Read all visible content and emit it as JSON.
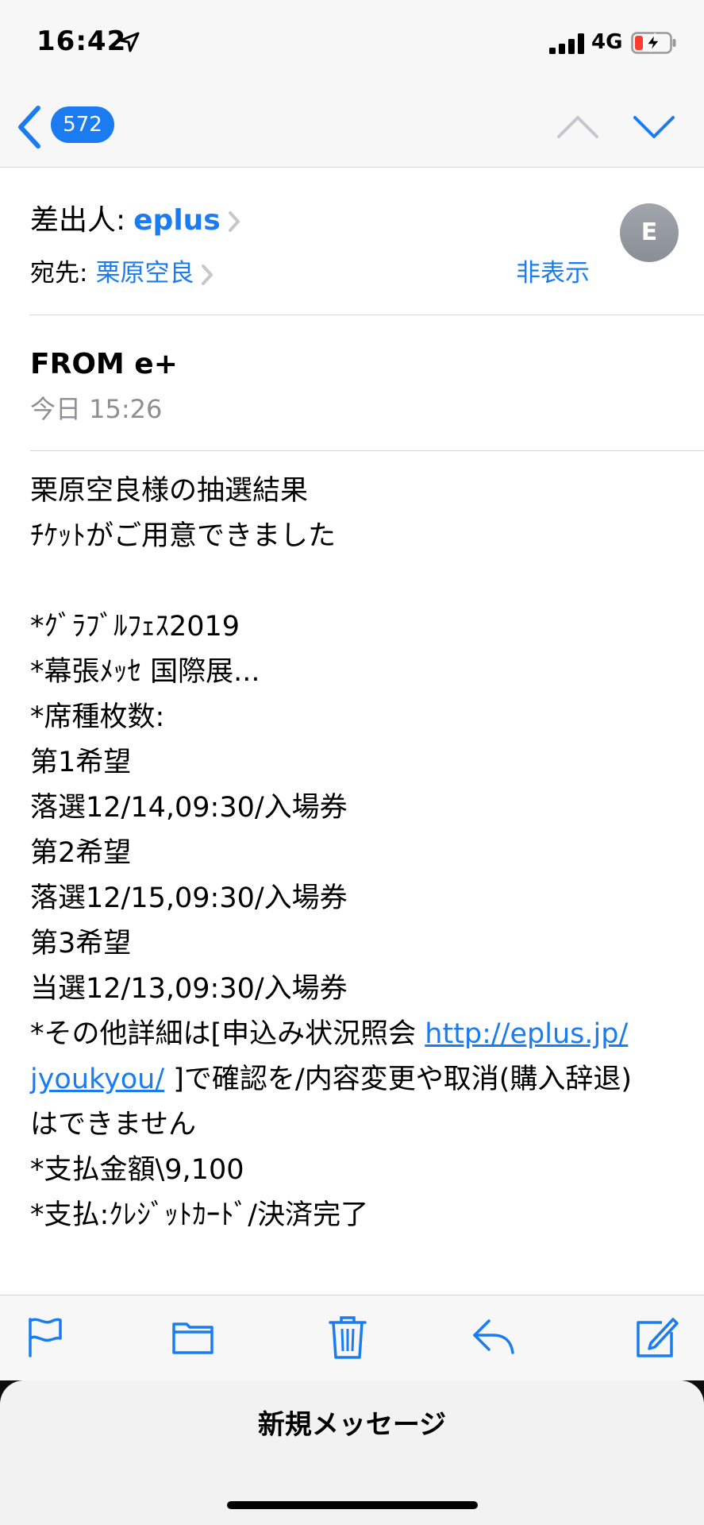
{
  "status_bar": {
    "time": "16:42",
    "network": "4G"
  },
  "nav": {
    "unread_count": "572"
  },
  "header": {
    "from_label": "差出人:",
    "from_name": "eplus",
    "to_label": "宛先:",
    "to_name": "栗原空良",
    "hide_label": "非表示",
    "avatar_initial": "E"
  },
  "message": {
    "subject": "FROM e+",
    "date": "今日 15:26",
    "lines": [
      "栗原空良様の抽選結果",
      "ﾁｹｯﾄがご用意できました",
      "",
      "*ｸﾞﾗﾌﾞﾙﾌｪｽ2019",
      "*幕張ﾒｯｾ 国際展...",
      "*席種枚数:",
      "第1希望",
      "落選12/14,09:30/入場券",
      "第2希望",
      "落選12/15,09:30/入場券",
      "第3希望",
      "当選12/13,09:30/入場券",
      "*その他詳細は[申込み状況照会 ",
      "http://eplus.jp/",
      "jyoukyou/",
      " ]で確認を/内容変更や取消(購入辞退)",
      "はできません",
      "*支払金額\\9,100",
      "*支払:ｸﾚｼﾞｯﾄｶｰﾄﾞ/決済完了"
    ]
  },
  "toolbar": {
    "icons": [
      "flag-icon",
      "folder-icon",
      "trash-icon",
      "reply-icon",
      "compose-icon"
    ]
  },
  "sheet": {
    "title": "新規メッセージ"
  },
  "colors": {
    "accent": "#1a7cf0",
    "bar_bg": "#f7f7f7",
    "secondary_text": "#8e8e93"
  }
}
